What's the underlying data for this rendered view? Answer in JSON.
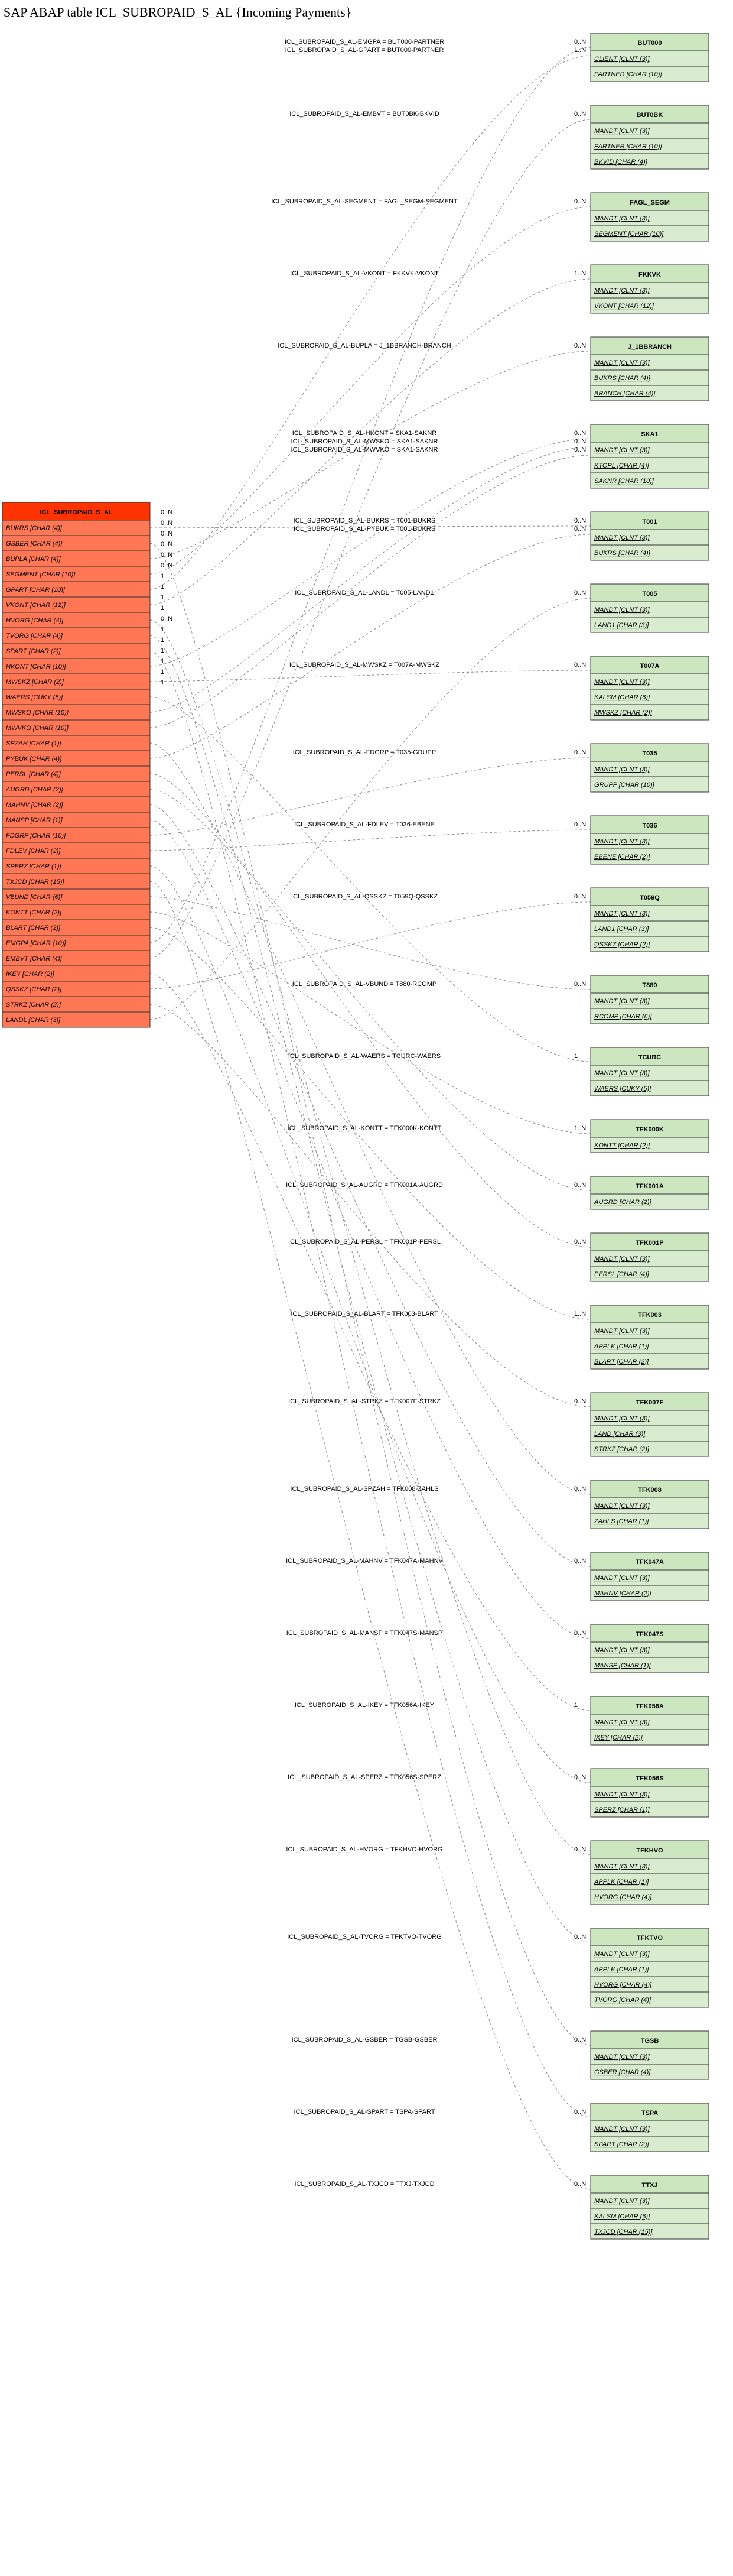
{
  "page_title": "SAP ABAP table ICL_SUBROPAID_S_AL {Incoming Payments}",
  "source_table": {
    "name": "ICL_SUBROPAID_S_AL",
    "fields": [
      "BUKRS [CHAR (4)]",
      "GSBER [CHAR (4)]",
      "BUPLA [CHAR (4)]",
      "SEGMENT [CHAR (10)]",
      "GPART [CHAR (10)]",
      "VKONT [CHAR (12)]",
      "HVORG [CHAR (4)]",
      "TVORG [CHAR (4)]",
      "SPART [CHAR (2)]",
      "HKONT [CHAR (10)]",
      "MWSKZ [CHAR (2)]",
      "WAERS [CUKY (5)]",
      "MWSKO [CHAR (10)]",
      "MWVKO [CHAR (10)]",
      "SPZAH [CHAR (1)]",
      "PYBUK [CHAR (4)]",
      "PERSL [CHAR (4)]",
      "AUGRD [CHAR (2)]",
      "MAHNV [CHAR (2)]",
      "MANSP [CHAR (1)]",
      "FDGRP [CHAR (10)]",
      "FDLEV [CHAR (2)]",
      "SPERZ [CHAR (1)]",
      "TXJCD [CHAR (15)]",
      "VBUND [CHAR (6)]",
      "KONTT [CHAR (2)]",
      "BLART [CHAR (2)]",
      "EMGPA [CHAR (10)]",
      "EMBVT [CHAR (4)]",
      "IKEY [CHAR (2)]",
      "QSSKZ [CHAR (2)]",
      "STRKZ [CHAR (2)]",
      "LANDL [CHAR (3)]"
    ]
  },
  "targets": [
    {
      "name": "BUT000",
      "fields": [
        {
          "t": "CLIENT [CLNT (3)]",
          "k": true
        },
        {
          "t": "PARTNER [CHAR (10)]",
          "k": false
        }
      ]
    },
    {
      "name": "BUT0BK",
      "fields": [
        {
          "t": "MANDT [CLNT (3)]",
          "k": true
        },
        {
          "t": "PARTNER [CHAR (10)]",
          "k": true
        },
        {
          "t": "BKVID [CHAR (4)]",
          "k": true
        }
      ]
    },
    {
      "name": "FAGL_SEGM",
      "fields": [
        {
          "t": "MANDT [CLNT (3)]",
          "k": true
        },
        {
          "t": "SEGMENT [CHAR (10)]",
          "k": true
        }
      ]
    },
    {
      "name": "FKKVK",
      "fields": [
        {
          "t": "MANDT [CLNT (3)]",
          "k": true
        },
        {
          "t": "VKONT [CHAR (12)]",
          "k": true
        }
      ]
    },
    {
      "name": "J_1BBRANCH",
      "fields": [
        {
          "t": "MANDT [CLNT (3)]",
          "k": true
        },
        {
          "t": "BUKRS [CHAR (4)]",
          "k": true
        },
        {
          "t": "BRANCH [CHAR (4)]",
          "k": true
        }
      ]
    },
    {
      "name": "SKA1",
      "fields": [
        {
          "t": "MANDT [CLNT (3)]",
          "k": true
        },
        {
          "t": "KTOPL [CHAR (4)]",
          "k": true
        },
        {
          "t": "SAKNR [CHAR (10)]",
          "k": true
        }
      ]
    },
    {
      "name": "T001",
      "fields": [
        {
          "t": "MANDT [CLNT (3)]",
          "k": true
        },
        {
          "t": "BUKRS [CHAR (4)]",
          "k": true
        }
      ]
    },
    {
      "name": "T005",
      "fields": [
        {
          "t": "MANDT [CLNT (3)]",
          "k": true
        },
        {
          "t": "LAND1 [CHAR (3)]",
          "k": true
        }
      ]
    },
    {
      "name": "T007A",
      "fields": [
        {
          "t": "MANDT [CLNT (3)]",
          "k": true
        },
        {
          "t": "KALSM [CHAR (6)]",
          "k": true
        },
        {
          "t": "MWSKZ [CHAR (2)]",
          "k": true
        }
      ]
    },
    {
      "name": "T035",
      "fields": [
        {
          "t": "MANDT [CLNT (3)]",
          "k": true
        },
        {
          "t": "GRUPP [CHAR (10)]",
          "k": false
        }
      ]
    },
    {
      "name": "T036",
      "fields": [
        {
          "t": "MANDT [CLNT (3)]",
          "k": true
        },
        {
          "t": "EBENE [CHAR (2)]",
          "k": true
        }
      ]
    },
    {
      "name": "T059Q",
      "fields": [
        {
          "t": "MANDT [CLNT (3)]",
          "k": true
        },
        {
          "t": "LAND1 [CHAR (3)]",
          "k": true
        },
        {
          "t": "QSSKZ [CHAR (2)]",
          "k": true
        }
      ]
    },
    {
      "name": "T880",
      "fields": [
        {
          "t": "MANDT [CLNT (3)]",
          "k": true
        },
        {
          "t": "RCOMP [CHAR (6)]",
          "k": true
        }
      ]
    },
    {
      "name": "TCURC",
      "fields": [
        {
          "t": "MANDT [CLNT (3)]",
          "k": true
        },
        {
          "t": "WAERS [CUKY (5)]",
          "k": true
        }
      ]
    },
    {
      "name": "TFK000K",
      "fields": [
        {
          "t": "KONTT [CHAR (2)]",
          "k": true
        }
      ]
    },
    {
      "name": "TFK001A",
      "fields": [
        {
          "t": "AUGRD [CHAR (2)]",
          "k": true
        }
      ]
    },
    {
      "name": "TFK001P",
      "fields": [
        {
          "t": "MANDT [CLNT (3)]",
          "k": true
        },
        {
          "t": "PERSL [CHAR (4)]",
          "k": true
        }
      ]
    },
    {
      "name": "TFK003",
      "fields": [
        {
          "t": "MANDT [CLNT (3)]",
          "k": true
        },
        {
          "t": "APPLK [CHAR (1)]",
          "k": true
        },
        {
          "t": "BLART [CHAR (2)]",
          "k": true
        }
      ]
    },
    {
      "name": "TFK007F",
      "fields": [
        {
          "t": "MANDT [CLNT (3)]",
          "k": true
        },
        {
          "t": "LAND [CHAR (3)]",
          "k": true
        },
        {
          "t": "STRKZ [CHAR (2)]",
          "k": true
        }
      ]
    },
    {
      "name": "TFK008",
      "fields": [
        {
          "t": "MANDT [CLNT (3)]",
          "k": true
        },
        {
          "t": "ZAHLS [CHAR (1)]",
          "k": true
        }
      ]
    },
    {
      "name": "TFK047A",
      "fields": [
        {
          "t": "MANDT [CLNT (3)]",
          "k": true
        },
        {
          "t": "MAHNV [CHAR (2)]",
          "k": true
        }
      ]
    },
    {
      "name": "TFK047S",
      "fields": [
        {
          "t": "MANDT [CLNT (3)]",
          "k": true
        },
        {
          "t": "MANSP [CHAR (1)]",
          "k": true
        }
      ]
    },
    {
      "name": "TFK056A",
      "fields": [
        {
          "t": "MANDT [CLNT (3)]",
          "k": true
        },
        {
          "t": "IKEY [CHAR (2)]",
          "k": true
        }
      ]
    },
    {
      "name": "TFK056S",
      "fields": [
        {
          "t": "MANDT [CLNT (3)]",
          "k": true
        },
        {
          "t": "SPERZ [CHAR (1)]",
          "k": true
        }
      ]
    },
    {
      "name": "TFKHVO",
      "fields": [
        {
          "t": "MANDT [CLNT (3)]",
          "k": true
        },
        {
          "t": "APPLK [CHAR (1)]",
          "k": true
        },
        {
          "t": "HVORG [CHAR (4)]",
          "k": true
        }
      ]
    },
    {
      "name": "TFKTVO",
      "fields": [
        {
          "t": "MANDT [CLNT (3)]",
          "k": true
        },
        {
          "t": "APPLK [CHAR (1)]",
          "k": true
        },
        {
          "t": "HVORG [CHAR (4)]",
          "k": true
        },
        {
          "t": "TVORG [CHAR (4)]",
          "k": true
        }
      ]
    },
    {
      "name": "TGSB",
      "fields": [
        {
          "t": "MANDT [CLNT (3)]",
          "k": true
        },
        {
          "t": "GSBER [CHAR (4)]",
          "k": true
        }
      ]
    },
    {
      "name": "TSPA",
      "fields": [
        {
          "t": "MANDT [CLNT (3)]",
          "k": true
        },
        {
          "t": "SPART [CHAR (2)]",
          "k": true
        }
      ]
    },
    {
      "name": "TTXJ",
      "fields": [
        {
          "t": "MANDT [CLNT (3)]",
          "k": true
        },
        {
          "t": "KALSM [CHAR (6)]",
          "k": true
        },
        {
          "t": "TXJCD [CHAR (15)]",
          "k": true
        }
      ]
    }
  ],
  "edges": [
    {
      "label": "ICL_SUBROPAID_S_AL-EMGPA = BUT000-PARTNER",
      "tgt": "BUT000",
      "card": "0..N",
      "srcRow": 27
    },
    {
      "label": "ICL_SUBROPAID_S_AL-GPART = BUT000-PARTNER",
      "tgt": "BUT000",
      "card": "1..N",
      "srcRow": 4
    },
    {
      "label": "ICL_SUBROPAID_S_AL-EMBVT = BUT0BK-BKVID",
      "tgt": "BUT0BK",
      "card": "0..N",
      "srcRow": 28
    },
    {
      "label": "ICL_SUBROPAID_S_AL-SEGMENT = FAGL_SEGM-SEGMENT",
      "tgt": "FAGL_SEGM",
      "card": "0..N",
      "srcRow": 3
    },
    {
      "label": "ICL_SUBROPAID_S_AL-VKONT = FKKVK-VKONT",
      "tgt": "FKKVK",
      "card": "1..N",
      "srcRow": 5
    },
    {
      "label": "ICL_SUBROPAID_S_AL-BUPLA = J_1BBRANCH-BRANCH",
      "tgt": "J_1BBRANCH",
      "card": "0..N",
      "srcRow": 2
    },
    {
      "label": "ICL_SUBROPAID_S_AL-HKONT = SKA1-SAKNR",
      "tgt": "SKA1",
      "card": "0..N",
      "srcRow": 9
    },
    {
      "label": "ICL_SUBROPAID_S_AL-MWSKO = SKA1-SAKNR",
      "tgt": "SKA1",
      "card": "0..N",
      "srcRow": 12
    },
    {
      "label": "ICL_SUBROPAID_S_AL-MWVKO = SKA1-SAKNR",
      "tgt": "SKA1",
      "card": "0..N",
      "srcRow": 13
    },
    {
      "label": "ICL_SUBROPAID_S_AL-BUKRS = T001-BUKRS",
      "tgt": "T001",
      "card": "0..N",
      "srcRow": 0
    },
    {
      "label": "ICL_SUBROPAID_S_AL-PYBUK = T001-BUKRS",
      "tgt": "T001",
      "card": "0..N",
      "srcRow": 15
    },
    {
      "label": "ICL_SUBROPAID_S_AL-LANDL = T005-LAND1",
      "tgt": "T005",
      "card": "0..N",
      "srcRow": 32
    },
    {
      "label": "ICL_SUBROPAID_S_AL-MWSKZ = T007A-MWSKZ",
      "tgt": "T007A",
      "card": "0..N",
      "srcRow": 10
    },
    {
      "label": "ICL_SUBROPAID_S_AL-FDGRP = T035-GRUPP",
      "tgt": "T035",
      "card": "0..N",
      "srcRow": 20
    },
    {
      "label": "ICL_SUBROPAID_S_AL-FDLEV = T036-EBENE",
      "tgt": "T036",
      "card": "0..N",
      "srcRow": 21
    },
    {
      "label": "ICL_SUBROPAID_S_AL-QSSKZ = T059Q-QSSKZ",
      "tgt": "T059Q",
      "card": "0..N",
      "srcRow": 30
    },
    {
      "label": "ICL_SUBROPAID_S_AL-VBUND = T880-RCOMP",
      "tgt": "T880",
      "card": "0..N",
      "srcRow": 24
    },
    {
      "label": "ICL_SUBROPAID_S_AL-WAERS = TCURC-WAERS",
      "tgt": "TCURC",
      "card": "1",
      "srcRow": 11
    },
    {
      "label": "ICL_SUBROPAID_S_AL-KONTT = TFK000K-KONTT",
      "tgt": "TFK000K",
      "card": "1..N",
      "srcRow": 25
    },
    {
      "label": "ICL_SUBROPAID_S_AL-AUGRD = TFK001A-AUGRD",
      "tgt": "TFK001A",
      "card": "0..N",
      "srcRow": 17
    },
    {
      "label": "ICL_SUBROPAID_S_AL-PERSL = TFK001P-PERSL",
      "tgt": "TFK001P",
      "card": "0..N",
      "srcRow": 16
    },
    {
      "label": "ICL_SUBROPAID_S_AL-BLART = TFK003-BLART",
      "tgt": "TFK003",
      "card": "1..N",
      "srcRow": 26
    },
    {
      "label": "ICL_SUBROPAID_S_AL-STRKZ = TFK007F-STRKZ",
      "tgt": "TFK007F",
      "card": "0..N",
      "srcRow": 31
    },
    {
      "label": "ICL_SUBROPAID_S_AL-SPZAH = TFK008-ZAHLS",
      "tgt": "TFK008",
      "card": "0..N",
      "srcRow": 14
    },
    {
      "label": "ICL_SUBROPAID_S_AL-MAHNV = TFK047A-MAHNV",
      "tgt": "TFK047A",
      "card": "0..N",
      "srcRow": 18
    },
    {
      "label": "ICL_SUBROPAID_S_AL-MANSP = TFK047S-MANSP",
      "tgt": "TFK047S",
      "card": "0..N",
      "srcRow": 19
    },
    {
      "label": "ICL_SUBROPAID_S_AL-IKEY = TFK056A-IKEY",
      "tgt": "TFK056A",
      "card": "1",
      "srcRow": 29
    },
    {
      "label": "ICL_SUBROPAID_S_AL-SPERZ = TFK056S-SPERZ",
      "tgt": "TFK056S",
      "card": "0..N",
      "srcRow": 22
    },
    {
      "label": "ICL_SUBROPAID_S_AL-HVORG = TFKHVO-HVORG",
      "tgt": "TFKHVO",
      "card": "0..N",
      "srcRow": 6
    },
    {
      "label": "ICL_SUBROPAID_S_AL-TVORG = TFKTVO-TVORG",
      "tgt": "TFKTVO",
      "card": "0..N",
      "srcRow": 7
    },
    {
      "label": "ICL_SUBROPAID_S_AL-GSBER = TGSB-GSBER",
      "tgt": "TGSB",
      "card": "0..N",
      "srcRow": 1
    },
    {
      "label": "ICL_SUBROPAID_S_AL-SPART = TSPA-SPART",
      "tgt": "TSPA",
      "card": "0..N",
      "srcRow": 8
    },
    {
      "label": "ICL_SUBROPAID_S_AL-TXJCD = TTXJ-TXJCD",
      "tgt": "TTXJ",
      "card": "0..N",
      "srcRow": 23
    }
  ],
  "src_side_cards": [
    "0..N",
    "0..N",
    "0..N",
    "0..N",
    "0..N",
    "0..N",
    "1",
    "1",
    "1",
    "1",
    "0..N",
    "1",
    "1",
    "1",
    "1",
    "1",
    "1"
  ]
}
